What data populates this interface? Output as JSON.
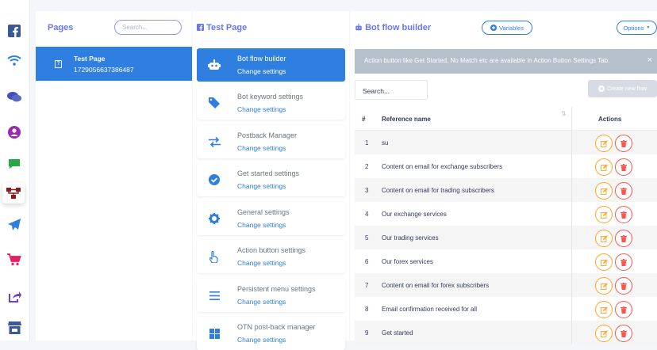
{
  "sidebar": {
    "icons": [
      {
        "name": "facebook-icon",
        "color": "#3b5998"
      },
      {
        "name": "wifi-icon",
        "color": "#2f7fe0"
      },
      {
        "name": "chat-bubbles-icon",
        "color": "#3f51b5"
      },
      {
        "name": "user-circle-icon",
        "color": "#9c27b0"
      },
      {
        "name": "comment-icon",
        "color": "#28a745"
      },
      {
        "name": "sitemap-icon",
        "color": "#8b1a1a"
      },
      {
        "name": "paper-plane-icon",
        "color": "#2f7fe0"
      },
      {
        "name": "shopping-cart-icon",
        "color": "#e91e63"
      },
      {
        "name": "share-icon",
        "color": "#6f42c1"
      },
      {
        "name": "store-icon",
        "color": "#3b5998"
      }
    ]
  },
  "pages_panel": {
    "title": "Pages",
    "search_placeholder": "Search...",
    "page": {
      "name": "Test Page",
      "id": "1729056637386487"
    }
  },
  "settings_panel": {
    "title": "Test Page",
    "items": [
      {
        "title": "Bot flow builder",
        "subtitle": "Change settings",
        "icon": "robot-icon",
        "active": true
      },
      {
        "title": "Bot keyword settings",
        "subtitle": "Change settings",
        "icon": "tag-icon"
      },
      {
        "title": "Postback Manager",
        "subtitle": "Change settings",
        "icon": "exchange-icon"
      },
      {
        "title": "Get started settings",
        "subtitle": "Change settings",
        "icon": "check-circle-icon"
      },
      {
        "title": "General settings",
        "subtitle": "Change settings",
        "icon": "gear-icon"
      },
      {
        "title": "Action button settings",
        "subtitle": "Change settings",
        "icon": "hand-pointer-icon"
      },
      {
        "title": "Persistent menu settings",
        "subtitle": "Change settings",
        "icon": "bars-icon"
      },
      {
        "title": "OTN post-back manager",
        "subtitle": "Change settings",
        "icon": "windows-icon"
      }
    ]
  },
  "builder_panel": {
    "title": "Bot flow builder",
    "variables_label": "Variables",
    "options_label": "Options",
    "alert_text": "Action button like Get Started, No Match etc are available in Action Button Settings Tab.",
    "alert_close": "×",
    "search_placeholder": "Search...",
    "create_label": "Create new flow",
    "table": {
      "headers": {
        "num": "#",
        "reference": "Reference name",
        "actions": "Actions",
        "sort": "⇅"
      },
      "rows": [
        {
          "num": "1",
          "reference": "su"
        },
        {
          "num": "2",
          "reference": "Content on email for exchange subscribers"
        },
        {
          "num": "3",
          "reference": "Content on email for trading subscribers"
        },
        {
          "num": "4",
          "reference": "Our exchange services"
        },
        {
          "num": "5",
          "reference": "Our trading services"
        },
        {
          "num": "6",
          "reference": "Our forex services"
        },
        {
          "num": "7",
          "reference": "Content on email for forex subscribers"
        },
        {
          "num": "8",
          "reference": "Email confirmation received for all"
        },
        {
          "num": "9",
          "reference": "Get started"
        }
      ]
    }
  },
  "colors": {
    "accent": "#2f7fe0",
    "edit": "#ffa426",
    "delete": "#fc544b",
    "title": "#6777ef"
  }
}
